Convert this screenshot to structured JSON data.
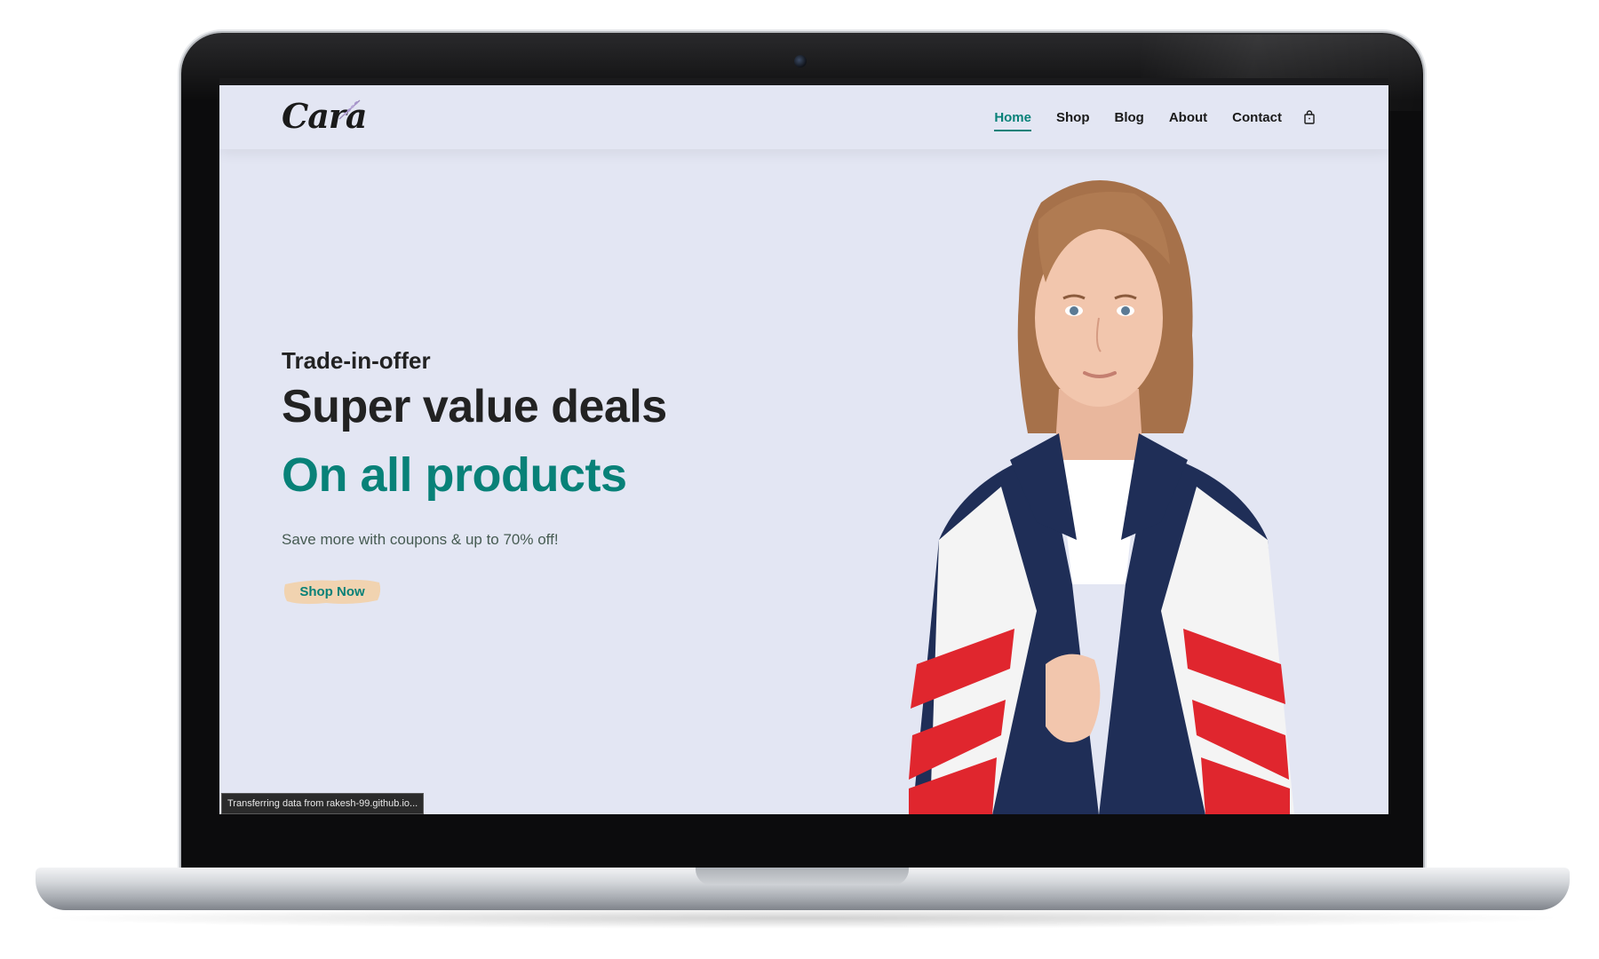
{
  "site": {
    "logo_text": "Cara"
  },
  "nav": {
    "items": [
      {
        "label": "Home",
        "active": true
      },
      {
        "label": "Shop",
        "active": false
      },
      {
        "label": "Blog",
        "active": false
      },
      {
        "label": "About",
        "active": false
      },
      {
        "label": "Contact",
        "active": false
      }
    ],
    "cart_icon": "shopping-bag-icon"
  },
  "hero": {
    "kicker": "Trade-in-offer",
    "title": "Super value deals",
    "subtitle": "On all products",
    "description": "Save more with coupons & up to 70% off!",
    "cta_label": "Shop Now"
  },
  "status_bar": {
    "text": "Transferring data from rakesh-99.github.io..."
  },
  "colors": {
    "accent": "#088178",
    "background": "#e3e6f3",
    "cta_background": "#f1d3b0",
    "text_dark": "#222222"
  }
}
